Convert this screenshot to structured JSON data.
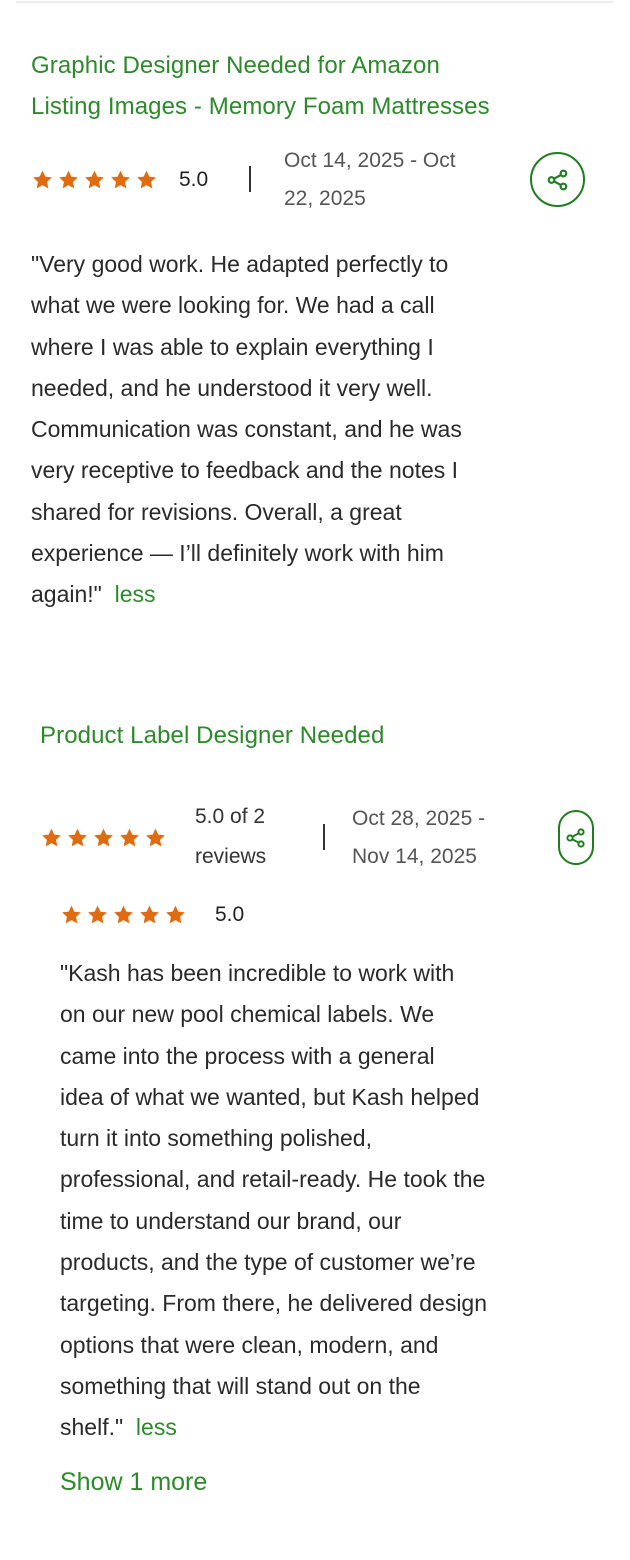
{
  "reviews": [
    {
      "title_line1": "Graphic Designer Needed for Amazon",
      "title_line2": "Listing Images - Memory Foam Mattresses",
      "rating": "5.0",
      "stars": 5,
      "date_line1": "Oct 14, 2025 - Oct",
      "date_line2": "22, 2025",
      "share_icon": "share-icon",
      "text_lines": [
        "\"Very good work. He adapted perfectly to",
        "what we were looking for. We had a call",
        "where I was able to explain everything I",
        "needed, and he understood it very well.",
        "Communication was constant, and he was",
        "very receptive to feedback and the notes I",
        "shared for revisions. Overall, a great",
        "experience — I’ll definitely work with him",
        "again!\""
      ],
      "less_label": "less"
    },
    {
      "title": "Product Label Designer Needed",
      "summary_line1": "5.0 of 2",
      "summary_line2": "reviews",
      "stars": 5,
      "date_line1": "Oct 28, 2025 -",
      "date_line2": "Nov 14, 2025",
      "share_icon": "share-icon",
      "inner_rating": "5.0",
      "text_lines": [
        "\"Kash has been incredible to work with",
        "on our new pool chemical labels. We",
        "came into the process with a general",
        "idea of what we wanted, but Kash helped",
        "turn it into something polished,",
        "professional, and retail-ready. He took the",
        "time to understand our brand, our",
        "products, and the type of customer we’re",
        "targeting. From there, he delivered design",
        "options that were clean, modern, and",
        "something that will stand out on the",
        "shelf.\""
      ],
      "less_label": "less",
      "show_more_label": "Show 1 more"
    }
  ],
  "colors": {
    "accent_green": "#2c8a2a",
    "star_orange": "#e06c12",
    "text": "#2a2a2a",
    "muted": "#555555"
  }
}
